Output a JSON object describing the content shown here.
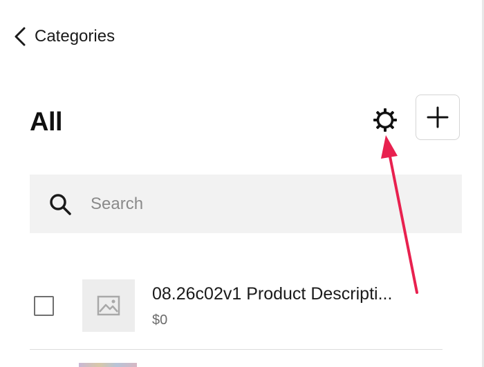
{
  "nav": {
    "back_label": "Categories",
    "back_icon": "chevron-left-icon"
  },
  "header": {
    "title": "All",
    "settings_icon": "gear-icon",
    "add_icon": "plus-icon"
  },
  "search": {
    "placeholder": "Search",
    "value": ""
  },
  "products": [
    {
      "name": "08.26c02v1 Product Descripti...",
      "price": "$0",
      "thumbnail_icon": "image-placeholder-icon"
    }
  ],
  "annotation": {
    "color": "#e8214f",
    "points_to": "gear-icon"
  }
}
